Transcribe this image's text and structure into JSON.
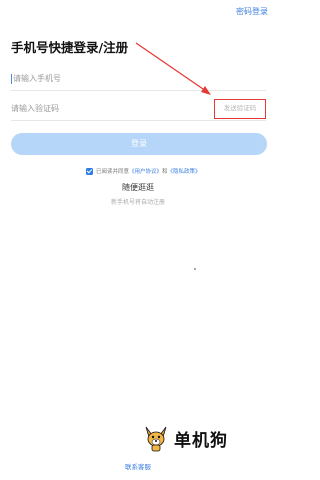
{
  "header": {
    "password_login": "密码登录"
  },
  "title": "手机号快捷登录/注册",
  "form": {
    "phone_placeholder": "请输入手机号",
    "code_placeholder": "请输入验证码",
    "send_code_label": "发送验证码",
    "login_label": "登录"
  },
  "agreement": {
    "prefix": "已阅读并同意",
    "user_agreement": "《用户协议》",
    "and": "和",
    "privacy_policy": "《隐私政策》"
  },
  "browse": {
    "label": "随便逛逛",
    "sub": "新手机号将自动注册"
  },
  "watermark": {
    "brand_text": "单机狗"
  },
  "footer": {
    "contact_label": "联系客服"
  },
  "colors": {
    "accent": "#3d7fe0",
    "button_disabled": "#b5d6f9",
    "annotation": "#e53935"
  }
}
